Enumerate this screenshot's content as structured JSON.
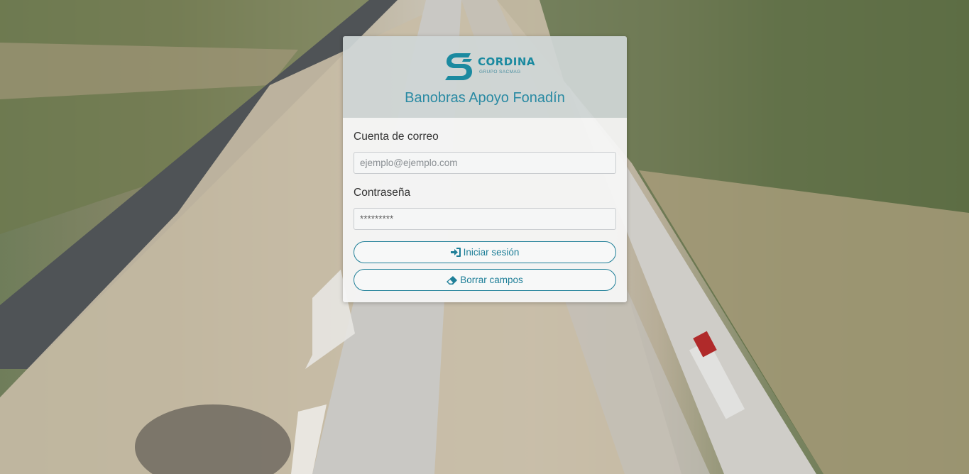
{
  "app": {
    "logo_text": "CORDINA",
    "logo_subtext": "GRUPO SACMAG",
    "title": "Banobras Apoyo Fonadín"
  },
  "form": {
    "email_label": "Cuenta de correo",
    "email_placeholder": "ejemplo@ejemplo.com",
    "email_value": "",
    "password_label": "Contraseña",
    "password_value": "*********",
    "login_button": "Iniciar sesión",
    "login_icon": "sign-in-icon",
    "clear_button": "Borrar campos",
    "clear_icon": "eraser-icon"
  },
  "colors": {
    "accent": "#1f7f98",
    "title": "#2a8aa3"
  }
}
